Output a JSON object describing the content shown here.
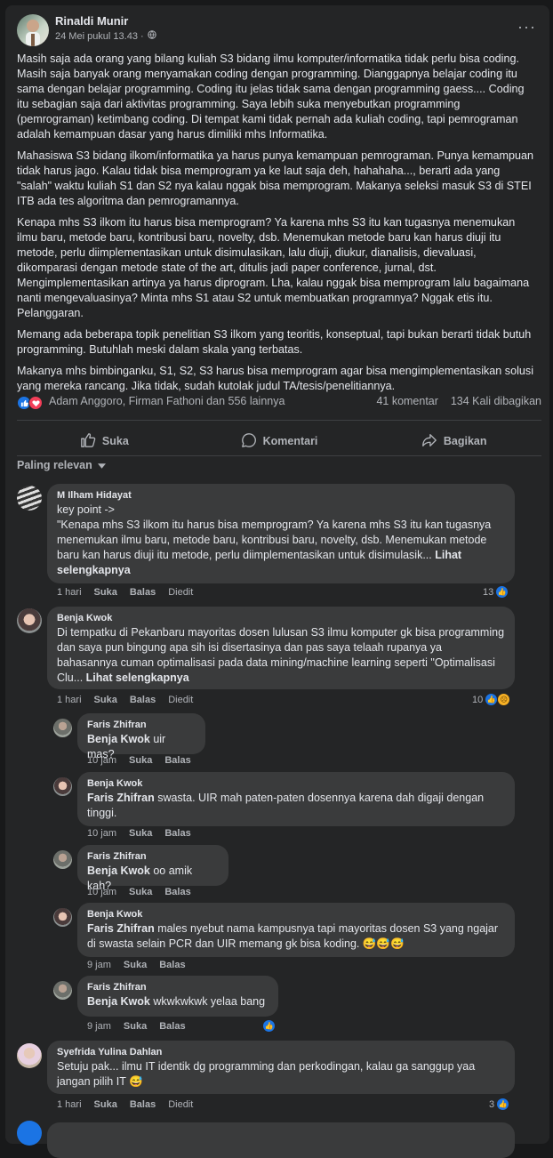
{
  "post": {
    "author": "Rinaldi Munir",
    "time": "24 Mei pukul 13.43 ·",
    "more": "···",
    "paragraphs": [
      "Masih saja ada orang yang bilang kuliah S3 bidang ilmu komputer/informatika tidak perlu bisa coding. Masih saja banyak orang menyamakan coding dengan programming. Dianggapnya belajar coding itu sama dengan belajar programming. Coding itu jelas tidak sama dengan programming gaess.... Coding itu sebagian saja dari aktivitas programming. Saya lebih suka menyebutkan programming (pemrograman) ketimbang coding. Di tempat kami tidak pernah ada kuliah coding, tapi pemrograman adalah kemampuan dasar yang harus dimiliki mhs Informatika.",
      "Mahasiswa S3 bidang ilkom/informatika ya harus punya kemampuan pemrograman. Punya kemampuan tidak harus jago. Kalau tidak bisa memprogram ya ke laut saja deh, hahahaha..., berarti ada yang \"salah\" waktu kuliah S1 dan S2 nya kalau nggak bisa memprogram. Makanya seleksi masuk S3 di STEI ITB ada tes algoritma dan pemrogramannya.",
      "Kenapa mhs S3 ilkom itu harus bisa memprogram? Ya karena mhs S3 itu kan tugasnya menemukan ilmu baru, metode baru, kontribusi baru, novelty, dsb. Menemukan metode baru kan harus diuji itu metode, perlu diimplementasikan untuk disimulasikan, lalu diuji, diukur, dianalisis, dievaluasi, dikomparasi dengan metode state of the art, ditulis jadi paper conference, jurnal, dst. Mengimplementasikan artinya ya harus diprogram. Lha, kalau nggak bisa memprogram lalu bagaimana nanti mengevaluasinya?  Minta mhs S1 atau S2 untuk membuatkan programnya? Nggak etis itu. Pelanggaran.",
      "Memang ada beberapa topik penelitian S3 ilkom yang teoritis, konseptual, tapi bukan berarti tidak butuh programming. Butuhlah meski dalam skala yang terbatas.",
      "Makanya mhs bimbinganku, S1, S2, S3 harus bisa memprogram agar bisa mengimplementasikan solusi yang mereka rancang. Jika tidak, sudah kutolak judul TA/tesis/penelitiannya."
    ],
    "reaction_names": "Adam Anggoro, Firman Fathoni dan 556 lainnya",
    "comments_count": "41 komentar",
    "shares_count": "134 Kali dibagikan"
  },
  "actions": {
    "like": "Suka",
    "comment": "Komentari",
    "share": "Bagikan"
  },
  "sort_label": "Paling relevan",
  "comments": [
    {
      "name": "M Ilham Hidayat",
      "line1": "key point ->",
      "text": "\"Kenapa mhs S3 ilkom itu harus bisa memprogram? Ya karena mhs S3 itu kan tugasnya menemukan ilmu baru, metode baru, kontribusi baru, novelty, dsb. Menemukan metode baru kan harus diuji itu metode, perlu diimplementasikan untuk disimulasik...",
      "see_more": "Lihat selengkapnya",
      "time": "1 hari",
      "like": "Suka",
      "reply": "Balas",
      "edited": "Diedit",
      "reactions": "13"
    },
    {
      "name": "Benja Kwok",
      "text": "Di tempatku di Pekanbaru mayoritas dosen lulusan S3 ilmu komputer gk bisa programming dan saya pun bingung apa sih isi disertasinya dan pas saya telaah rupanya ya bahasannya cuman optimalisasi pada data mining/machine learning seperti \"Optimalisasi Clu...",
      "see_more": "Lihat selengkapnya",
      "time": "1 hari",
      "like": "Suka",
      "reply": "Balas",
      "edited": "Diedit",
      "reactions": "10"
    },
    {
      "name": "Syefrida Yulina Dahlan",
      "text": "Setuju pak... ilmu IT identik dg programming dan perkodingan, kalau ga sanggup yaa jangan pilih IT 😅",
      "time": "1 hari",
      "like": "Suka",
      "reply": "Balas",
      "edited": "Diedit",
      "reactions": "3"
    }
  ],
  "replies": [
    {
      "name": "Faris Zhifran",
      "tag": "Benja Kwok",
      "text": " uir mas?",
      "time": "10 jam",
      "like": "Suka",
      "reply": "Balas"
    },
    {
      "name": "Benja Kwok",
      "tag": "Faris Zhifran",
      "text": " swasta. UIR mah paten-paten dosennya karena dah digaji dengan tinggi.",
      "time": "10 jam",
      "like": "Suka",
      "reply": "Balas"
    },
    {
      "name": "Faris Zhifran",
      "tag": "Benja Kwok",
      "text": " oo amik kah?",
      "time": "10 jam",
      "like": "Suka",
      "reply": "Balas"
    },
    {
      "name": "Benja Kwok",
      "tag": "Faris Zhifran",
      "text": " males nyebut nama kampusnya tapi mayoritas dosen S3 yang ngajar di swasta selain PCR dan UIR memang gk bisa koding. 😅😅😅",
      "time": "9 jam",
      "like": "Suka",
      "reply": "Balas"
    },
    {
      "name": "Faris Zhifran",
      "tag": "Benja Kwok",
      "text": " wkwkwkwk yelaa bang",
      "time": "9 jam",
      "like": "Suka",
      "reply": "Balas"
    }
  ],
  "icons": {
    "globe": "globe-icon",
    "like": "thumbs-up-icon",
    "love": "heart-icon",
    "comment": "comment-bubble-icon",
    "share": "share-arrow-icon",
    "sad": "sad-face-icon"
  },
  "colors": {
    "background": "#18191a",
    "card": "#242526",
    "bubble": "#3a3b3c",
    "like_blue": "#1b74e4",
    "love_red": "#f33e58"
  }
}
